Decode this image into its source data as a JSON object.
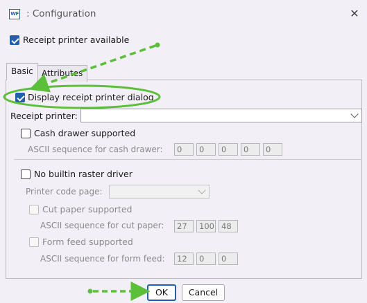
{
  "window": {
    "icon_text": "WF",
    "title": ": Configuration",
    "close_glyph": "✕"
  },
  "receipt_printer_available": {
    "label": "Receipt printer available",
    "checked": true
  },
  "tabs": [
    {
      "label": "Basic",
      "active": true
    },
    {
      "label": "Attributes",
      "active": false
    }
  ],
  "basic": {
    "display_dialog": {
      "label": "Display receipt printer dialog",
      "checked": true
    },
    "receipt_printer": {
      "label": "Receipt printer:",
      "value": ""
    },
    "cash_drawer": {
      "label": "Cash drawer supported",
      "checked": false,
      "ascii_label": "ASCII sequence for cash drawer:",
      "values": [
        "0",
        "0",
        "0",
        "0",
        "0"
      ]
    },
    "no_builtin_raster": {
      "label": "No builtin raster driver",
      "checked": false,
      "code_page_label": "Printer code page:",
      "code_page_value": "",
      "cut_paper": {
        "label": "Cut paper supported",
        "checked": false,
        "ascii_label": "ASCII sequence for cut paper:",
        "values": [
          "27",
          "100",
          "48"
        ]
      },
      "form_feed": {
        "label": "Form feed supported",
        "checked": false,
        "ascii_label": "ASCII sequence for form feed:",
        "values": [
          "12",
          "0",
          "0"
        ]
      }
    }
  },
  "buttons": {
    "ok": "OK",
    "cancel": "Cancel"
  },
  "annotation_colors": {
    "green": "#5cbf3a"
  }
}
